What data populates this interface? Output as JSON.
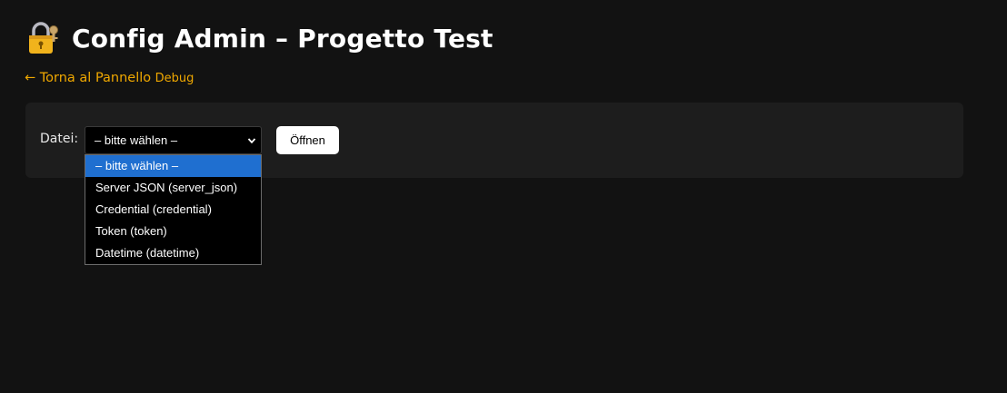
{
  "header": {
    "title": "Config Admin – Progetto Test",
    "icon": "lock-with-key-icon"
  },
  "nav": {
    "back_text": "← Torna al Pannello",
    "back_suffix": "Debug"
  },
  "file_picker": {
    "label": "Datei:",
    "selected": "– bitte wählen –",
    "open_label": "Öffnen",
    "options": [
      "– bitte wählen –",
      "Server JSON (server_json)",
      "Credential (credential)",
      "Token (token)",
      "Datetime (datetime)"
    ],
    "highlighted_index": 0
  },
  "colors": {
    "background": "#121212",
    "panel": "#1d1d1d",
    "link": "#f0a800",
    "highlight": "#1f6fd0"
  }
}
